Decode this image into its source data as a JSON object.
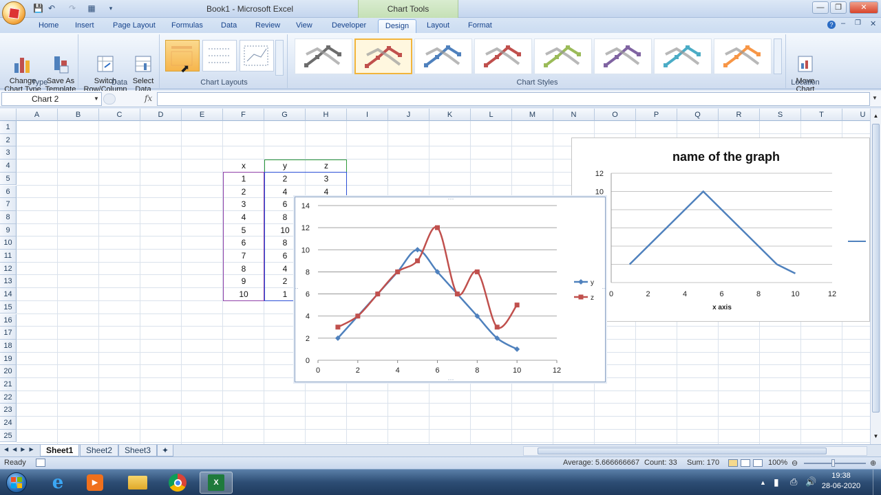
{
  "window": {
    "title": "Book1 - Microsoft Excel",
    "context_tab": "Chart Tools"
  },
  "ribbon_tabs": [
    "Home",
    "Insert",
    "Page Layout",
    "Formulas",
    "Data",
    "Review",
    "View",
    "Developer",
    "Design",
    "Layout",
    "Format"
  ],
  "active_tab": "Design",
  "ribbon": {
    "type_group": {
      "label": "Type",
      "change_chart_type": "Change\nChart Type",
      "save_as_template": "Save As\nTemplate"
    },
    "data_group": {
      "label": "Data",
      "switch_row_column": "Switch\nRow/Column",
      "select_data": "Select\nData"
    },
    "chart_layouts_group": {
      "label": "Chart Layouts"
    },
    "chart_styles_group": {
      "label": "Chart Styles",
      "style_colors": [
        "#6d6d6d",
        "#c0504d",
        "#4f81bd",
        "#c0504d",
        "#9bbb59",
        "#8064a2",
        "#4bacc6",
        "#f79646"
      ],
      "selected_index": 1
    },
    "location_group": {
      "label": "Location",
      "move_chart": "Move\nChart"
    }
  },
  "formula_bar": {
    "name_box": "Chart 2",
    "fx_label": "fx",
    "value": ""
  },
  "columns": [
    "A",
    "B",
    "C",
    "D",
    "E",
    "F",
    "G",
    "H",
    "I",
    "J",
    "K",
    "L",
    "M",
    "N",
    "O",
    "P",
    "Q",
    "R",
    "S",
    "T",
    "U"
  ],
  "rows": [
    "1",
    "2",
    "3",
    "4",
    "5",
    "6",
    "7",
    "8",
    "9",
    "10",
    "11",
    "12",
    "13",
    "14",
    "15",
    "16",
    "17",
    "18",
    "19",
    "20",
    "21",
    "22",
    "23",
    "24",
    "25"
  ],
  "table": {
    "headers": [
      "x",
      "y",
      "z"
    ],
    "rows": [
      [
        "1",
        "2",
        "3"
      ],
      [
        "2",
        "4",
        "4"
      ],
      [
        "3",
        "6",
        ""
      ],
      [
        "4",
        "8",
        ""
      ],
      [
        "5",
        "10",
        ""
      ],
      [
        "6",
        "8",
        ""
      ],
      [
        "7",
        "6",
        ""
      ],
      [
        "8",
        "4",
        ""
      ],
      [
        "9",
        "2",
        ""
      ],
      [
        "10",
        "1",
        ""
      ]
    ]
  },
  "sheets": [
    "Sheet1",
    "Sheet2",
    "Sheet3"
  ],
  "active_sheet": "Sheet1",
  "status": {
    "ready": "Ready",
    "average": "Average: 5.666666667",
    "count": "Count: 33",
    "sum": "Sum: 170",
    "zoom": "100%"
  },
  "clock": {
    "time": "19:38",
    "date": "28-06-2020"
  },
  "chart_data": [
    {
      "type": "line",
      "smooth": true,
      "title": "",
      "xlabel": "",
      "ylabel": "",
      "xlim": [
        0,
        12
      ],
      "ylim": [
        0,
        14
      ],
      "xticks": [
        "0",
        "2",
        "4",
        "6",
        "8",
        "10",
        "12"
      ],
      "yticks": [
        "0",
        "2",
        "4",
        "6",
        "8",
        "10",
        "12",
        "14"
      ],
      "grid": "horizontal",
      "legend": "right",
      "series": [
        {
          "name": "y",
          "color": "#4f81bd",
          "marker": "diamond",
          "x": [
            1,
            2,
            3,
            4,
            5,
            6,
            7,
            8,
            9,
            10
          ],
          "values": [
            2,
            4,
            6,
            8,
            10,
            8,
            6,
            4,
            2,
            1
          ]
        },
        {
          "name": "z",
          "color": "#c0504d",
          "marker": "square",
          "x": [
            1,
            2,
            3,
            4,
            5,
            6,
            7,
            8,
            9,
            10
          ],
          "values": [
            3,
            4,
            6,
            8,
            9,
            12,
            6,
            8,
            3,
            5
          ]
        }
      ]
    },
    {
      "type": "line",
      "title": "name of the graph",
      "xlabel": "x axis",
      "ylabel": "",
      "xlim": [
        0,
        12
      ],
      "ylim": [
        0,
        12
      ],
      "xticks": [
        "0",
        "2",
        "4",
        "6",
        "8",
        "10",
        "12"
      ],
      "yticks": [
        "12",
        "10"
      ],
      "grid": "horizontal",
      "series": [
        {
          "color": "#4f81bd",
          "x": [
            1,
            5,
            9,
            10
          ],
          "values": [
            2,
            10,
            2,
            1
          ]
        }
      ]
    }
  ]
}
